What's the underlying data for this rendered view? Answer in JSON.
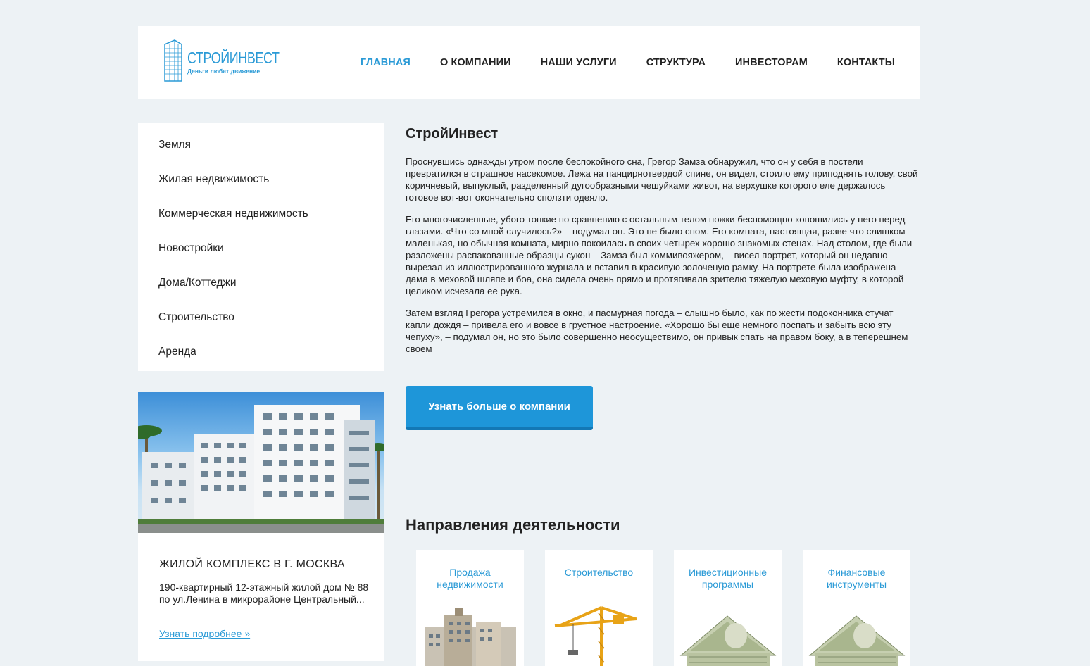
{
  "colors": {
    "accent": "#2a9ad6",
    "button": "#1e96d9",
    "background": "#edf2f5"
  },
  "logo": {
    "name": "СТРОЙИНВЕСТ",
    "tagline": "Деньги любят движение",
    "icon": "building-logo-icon"
  },
  "nav": [
    {
      "label": "ГЛАВНАЯ",
      "active": true
    },
    {
      "label": "О КОМПАНИИ"
    },
    {
      "label": "НАШИ УСЛУГИ"
    },
    {
      "label": "СТРУКТУРА"
    },
    {
      "label": "ИНВЕСТОРАМ"
    },
    {
      "label": "КОНТАКТЫ"
    }
  ],
  "sidebar": {
    "items": [
      {
        "label": "Земля"
      },
      {
        "label": "Жилая недвижимость"
      },
      {
        "label": "Коммерческая недвижимость"
      },
      {
        "label": "Новостройки"
      },
      {
        "label": "Дома/Коттеджи"
      },
      {
        "label": "Строительство"
      },
      {
        "label": "Аренда"
      }
    ]
  },
  "card": {
    "title": "ЖИЛОЙ КОМПЛЕКС В Г. МОСКВА",
    "text": "190-квартирный 12-этажный жилой дом № 88 по ул.Ленина в микрорайоне Центральный...",
    "link": "Узнать подробнее »"
  },
  "main": {
    "title": "СтройИнвест",
    "paragraphs": [
      "Проснувшись однажды утром после беспокойного сна, Грегор Замза обнаружил, что он у себя в постели превратился в страшное насекомое. Лежа на панцирнотвердой спине, он видел, стоило ему приподнять голову, свой коричневый, выпуклый, разделенный дугообразными чешуйками живот, на верхушке которого еле держалось готовое вот-вот окончательно сползти одеяло.",
      "Его многочисленные, убого тонкие по сравнению с остальным телом ножки беспомощно копошились у него перед глазами. «Что со мной случилось?» – подумал он. Это не было сном. Его комната, настоящая, разве что слишком маленькая, но обычная комната, мирно покоилась в своих четырех хорошо знакомых стенах. Над столом, где были разложены распакованные образцы сукон – Замза был коммивояжером, – висел портрет, который он недавно вырезал из иллюстрированного журнала и вставил в красивую золоченую рамку. На портрете была изображена дама в меховой шляпе и боа, она сидела очень прямо и протягивала зрителю тяжелую меховую муфту, в которой целиком исчезала ее рука.",
      "Затем взгляд Грегора устремился в окно, и пасмурная погода – слышно было, как по жести подоконника стучат капли дождя – привела его и вовсе в грустное настроение. «Хорошо бы еще немного поспать и забыть всю эту чепуху», – подумал он, но это было совершенно неосуществимо, он привык спать на правом боку, а в теперешнем своем"
    ],
    "button": "Узнать больше о компании"
  },
  "directions": {
    "title": "Направления деятельности",
    "tiles": [
      {
        "label": "Продажа недвижимости",
        "icon": "tower-building-icon"
      },
      {
        "label": "Строительство",
        "icon": "crane-icon"
      },
      {
        "label": "Инвестиционные программы",
        "icon": "money-house-icon"
      },
      {
        "label": "Финансовые инструменты",
        "icon": "money-house-icon"
      }
    ]
  }
}
